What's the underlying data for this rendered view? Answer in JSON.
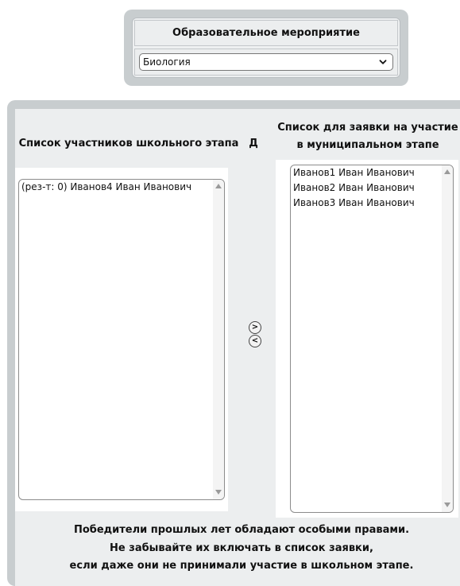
{
  "event": {
    "title": "Образовательное мероприятие",
    "selected": "Биология"
  },
  "left": {
    "header": "Список участников школьного этапа",
    "items": [
      "(рез-т: 0) Иванов4 Иван Иванович"
    ]
  },
  "mid": {
    "header": "Д",
    "move_right": ">",
    "move_left": "<"
  },
  "right": {
    "header_line1": "Список для заявки на участие",
    "header_line2": "в муниципальном этапе",
    "items": [
      "Иванов1 Иван Иванович",
      "Иванов2 Иван Иванович",
      "Иванов3 Иван Иванович"
    ]
  },
  "note": {
    "line1": "Победители прошлых лет обладают особыми правами.",
    "line2": "Не забывайте их включать в список заявки,",
    "line3": "если даже они не принимали участие в школьном этапе."
  }
}
